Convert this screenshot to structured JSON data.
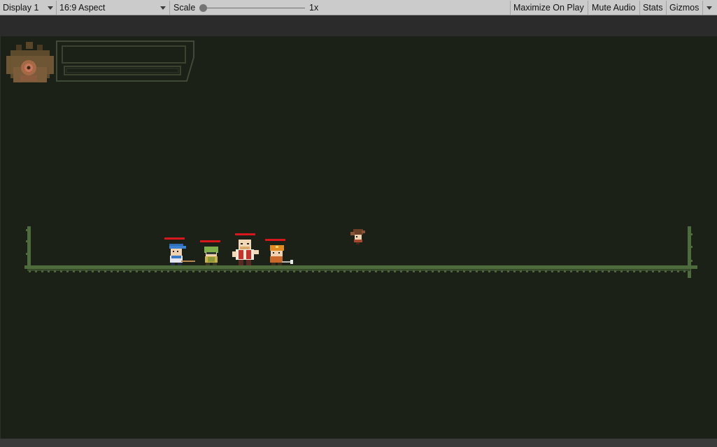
{
  "toolbar": {
    "display_select": "Display 1",
    "aspect_select": "16:9 Aspect",
    "scale_label": "Scale",
    "scale_value": "1x",
    "scale_level": 0,
    "maximize_on_play": "Maximize On Play",
    "mute_audio": "Mute Audio",
    "stats": "Stats",
    "gizmos": "Gizmos"
  },
  "scene": {
    "background_color": "#1c2117",
    "ground_color": "#4e6b3b",
    "health_bar_color": "#d8171c",
    "player_portrait_icon": "owl-portrait-icon",
    "player_bars": "empty-health-bar-frame",
    "characters": [
      {
        "name": "blue-cap-hero",
        "icon": "blue-cap-character-icon",
        "health_fraction": 1
      },
      {
        "name": "green-hood-hero",
        "icon": "green-hood-character-icon",
        "health_fraction": 1
      },
      {
        "name": "bald-brawler-hero",
        "icon": "bald-brawler-character-icon",
        "health_fraction": 1
      },
      {
        "name": "orange-helmet-hero",
        "icon": "orange-helmet-character-icon",
        "health_fraction": 1
      }
    ],
    "enemy": {
      "name": "flying-enemy",
      "icon": "brown-flying-creature-icon"
    }
  }
}
